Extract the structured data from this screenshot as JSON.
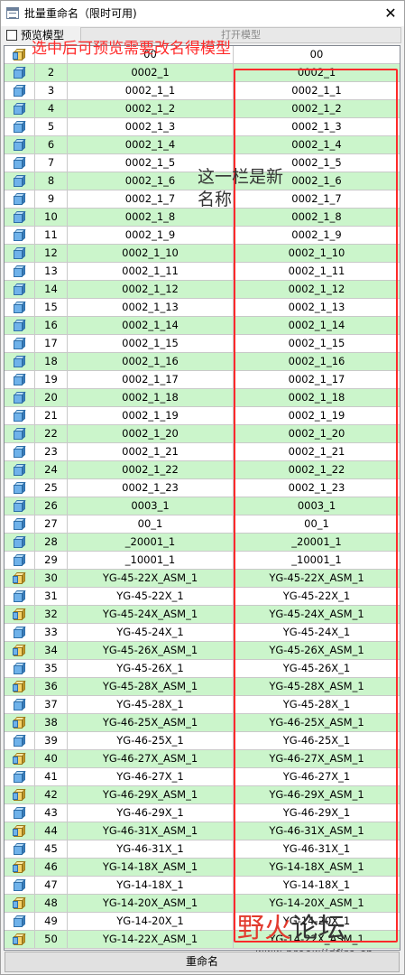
{
  "window": {
    "title": "批量重命名（限时可用)",
    "close_glyph": "✕"
  },
  "toolbar": {
    "preview_label": "预览模型",
    "open_label": "打开模型"
  },
  "annotations": {
    "top": "选中后可预览需要改名得模型",
    "mid": "这一栏是新名称"
  },
  "watermark": {
    "part1": "野",
    "part2": "火",
    "part3": "论坛",
    "url": "www.proewildfire.cn"
  },
  "bottom_button": "重命名",
  "colors": {
    "row_even": "#cbf5cb",
    "row_odd": "#ffffff",
    "annotation_red": "#ff2a2a"
  },
  "icons": {
    "part": "part-cube-icon",
    "assembly": "assembly-cube-icon"
  },
  "rows": [
    {
      "type": "asm",
      "num": "",
      "old": "00",
      "new": "00"
    },
    {
      "type": "prt",
      "num": "2",
      "old": "0002_1",
      "new": "0002_1"
    },
    {
      "type": "prt",
      "num": "3",
      "old": "0002_1_1",
      "new": "0002_1_1"
    },
    {
      "type": "prt",
      "num": "4",
      "old": "0002_1_2",
      "new": "0002_1_2"
    },
    {
      "type": "prt",
      "num": "5",
      "old": "0002_1_3",
      "new": "0002_1_3"
    },
    {
      "type": "prt",
      "num": "6",
      "old": "0002_1_4",
      "new": "0002_1_4"
    },
    {
      "type": "prt",
      "num": "7",
      "old": "0002_1_5",
      "new": "0002_1_5"
    },
    {
      "type": "prt",
      "num": "8",
      "old": "0002_1_6",
      "new": "0002_1_6"
    },
    {
      "type": "prt",
      "num": "9",
      "old": "0002_1_7",
      "new": "0002_1_7"
    },
    {
      "type": "prt",
      "num": "10",
      "old": "0002_1_8",
      "new": "0002_1_8"
    },
    {
      "type": "prt",
      "num": "11",
      "old": "0002_1_9",
      "new": "0002_1_9"
    },
    {
      "type": "prt",
      "num": "12",
      "old": "0002_1_10",
      "new": "0002_1_10"
    },
    {
      "type": "prt",
      "num": "13",
      "old": "0002_1_11",
      "new": "0002_1_11"
    },
    {
      "type": "prt",
      "num": "14",
      "old": "0002_1_12",
      "new": "0002_1_12"
    },
    {
      "type": "prt",
      "num": "15",
      "old": "0002_1_13",
      "new": "0002_1_13"
    },
    {
      "type": "prt",
      "num": "16",
      "old": "0002_1_14",
      "new": "0002_1_14"
    },
    {
      "type": "prt",
      "num": "17",
      "old": "0002_1_15",
      "new": "0002_1_15"
    },
    {
      "type": "prt",
      "num": "18",
      "old": "0002_1_16",
      "new": "0002_1_16"
    },
    {
      "type": "prt",
      "num": "19",
      "old": "0002_1_17",
      "new": "0002_1_17"
    },
    {
      "type": "prt",
      "num": "20",
      "old": "0002_1_18",
      "new": "0002_1_18"
    },
    {
      "type": "prt",
      "num": "21",
      "old": "0002_1_19",
      "new": "0002_1_19"
    },
    {
      "type": "prt",
      "num": "22",
      "old": "0002_1_20",
      "new": "0002_1_20"
    },
    {
      "type": "prt",
      "num": "23",
      "old": "0002_1_21",
      "new": "0002_1_21"
    },
    {
      "type": "prt",
      "num": "24",
      "old": "0002_1_22",
      "new": "0002_1_22"
    },
    {
      "type": "prt",
      "num": "25",
      "old": "0002_1_23",
      "new": "0002_1_23"
    },
    {
      "type": "prt",
      "num": "26",
      "old": "0003_1",
      "new": "0003_1"
    },
    {
      "type": "prt",
      "num": "27",
      "old": "00_1",
      "new": "00_1"
    },
    {
      "type": "prt",
      "num": "28",
      "old": "_20001_1",
      "new": "_20001_1"
    },
    {
      "type": "prt",
      "num": "29",
      "old": "_10001_1",
      "new": "_10001_1"
    },
    {
      "type": "asm",
      "num": "30",
      "old": "YG-45-22X_ASM_1",
      "new": "YG-45-22X_ASM_1"
    },
    {
      "type": "prt",
      "num": "31",
      "old": "YG-45-22X_1",
      "new": "YG-45-22X_1"
    },
    {
      "type": "asm",
      "num": "32",
      "old": "YG-45-24X_ASM_1",
      "new": "YG-45-24X_ASM_1"
    },
    {
      "type": "prt",
      "num": "33",
      "old": "YG-45-24X_1",
      "new": "YG-45-24X_1"
    },
    {
      "type": "asm",
      "num": "34",
      "old": "YG-45-26X_ASM_1",
      "new": "YG-45-26X_ASM_1"
    },
    {
      "type": "prt",
      "num": "35",
      "old": "YG-45-26X_1",
      "new": "YG-45-26X_1"
    },
    {
      "type": "asm",
      "num": "36",
      "old": "YG-45-28X_ASM_1",
      "new": "YG-45-28X_ASM_1"
    },
    {
      "type": "prt",
      "num": "37",
      "old": "YG-45-28X_1",
      "new": "YG-45-28X_1"
    },
    {
      "type": "asm",
      "num": "38",
      "old": "YG-46-25X_ASM_1",
      "new": "YG-46-25X_ASM_1"
    },
    {
      "type": "prt",
      "num": "39",
      "old": "YG-46-25X_1",
      "new": "YG-46-25X_1"
    },
    {
      "type": "asm",
      "num": "40",
      "old": "YG-46-27X_ASM_1",
      "new": "YG-46-27X_ASM_1"
    },
    {
      "type": "prt",
      "num": "41",
      "old": "YG-46-27X_1",
      "new": "YG-46-27X_1"
    },
    {
      "type": "asm",
      "num": "42",
      "old": "YG-46-29X_ASM_1",
      "new": "YG-46-29X_ASM_1"
    },
    {
      "type": "prt",
      "num": "43",
      "old": "YG-46-29X_1",
      "new": "YG-46-29X_1"
    },
    {
      "type": "asm",
      "num": "44",
      "old": "YG-46-31X_ASM_1",
      "new": "YG-46-31X_ASM_1"
    },
    {
      "type": "prt",
      "num": "45",
      "old": "YG-46-31X_1",
      "new": "YG-46-31X_1"
    },
    {
      "type": "asm",
      "num": "46",
      "old": "YG-14-18X_ASM_1",
      "new": "YG-14-18X_ASM_1"
    },
    {
      "type": "prt",
      "num": "47",
      "old": "YG-14-18X_1",
      "new": "YG-14-18X_1"
    },
    {
      "type": "asm",
      "num": "48",
      "old": "YG-14-20X_ASM_1",
      "new": "YG-14-20X_ASM_1"
    },
    {
      "type": "prt",
      "num": "49",
      "old": "YG-14-20X_1",
      "new": "YG-14-20X_1"
    },
    {
      "type": "asm",
      "num": "50",
      "old": "YG-14-22X_ASM_1",
      "new": "YG-14-22X_ASM_1"
    }
  ]
}
